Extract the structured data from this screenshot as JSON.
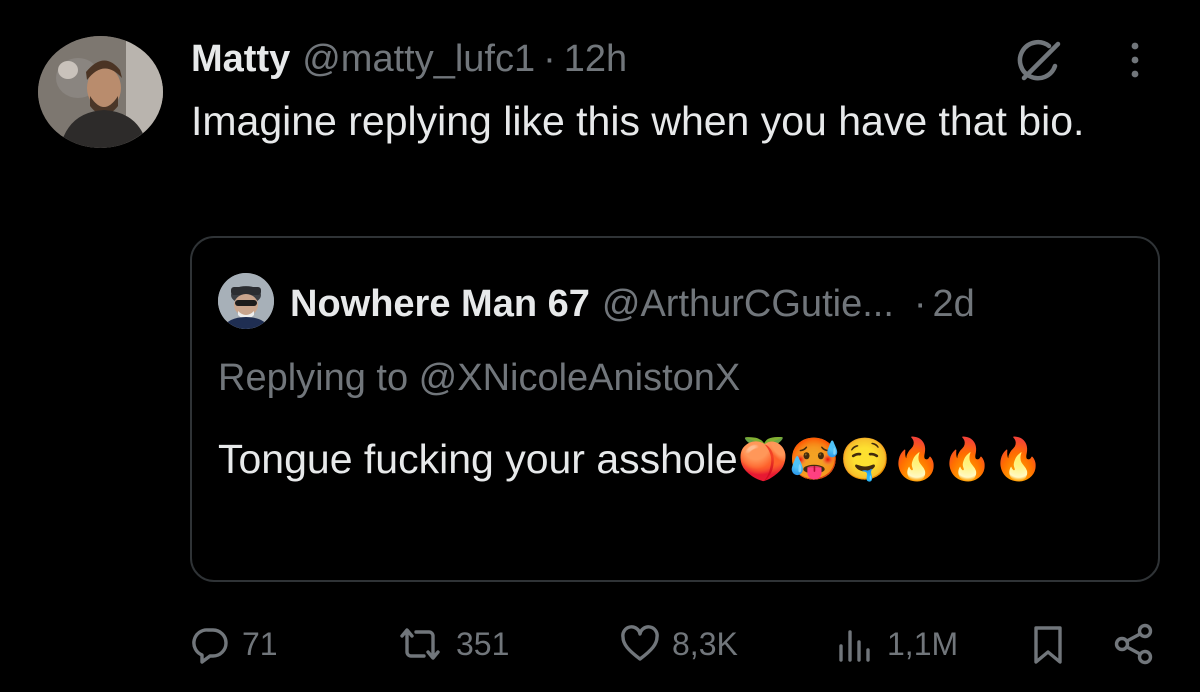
{
  "tweet": {
    "author_name": "Matty",
    "author_handle": "@matty_lufc1",
    "separator": "·",
    "time": "12h",
    "text": "Imagine replying like this when you have that bio.",
    "icons": {
      "grok": "grok-icon",
      "more": "more-options-icon"
    }
  },
  "quote": {
    "author_name": "Nowhere Man 67",
    "author_handle": "@ArthurCGutie...",
    "separator": "·",
    "time": "2d",
    "replying_to": "Replying to @XNicoleAnistonX",
    "text": "Tongue fucking your asshole🍑🥵🤤🔥🔥🔥"
  },
  "actions": {
    "replies": "71",
    "reposts": "351",
    "likes": "8,3K",
    "views": "1,1M",
    "icons": [
      "reply-icon",
      "repost-icon",
      "like-icon",
      "views-icon",
      "bookmark-icon",
      "share-icon"
    ]
  },
  "colors": {
    "background": "#000000",
    "text_primary": "#e7e9ea",
    "text_secondary": "#71767b",
    "border": "#2f3336"
  }
}
